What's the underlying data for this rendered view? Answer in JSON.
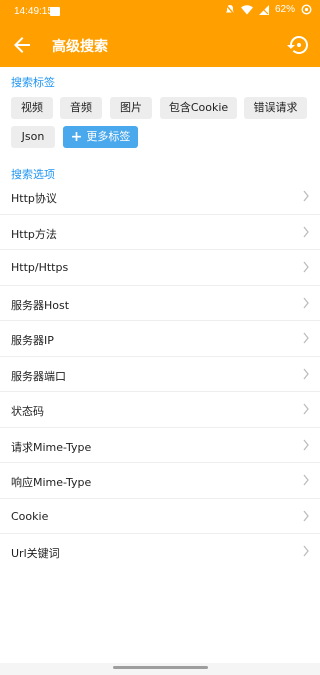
{
  "status": {
    "time": "14:49:15",
    "battery": "62%"
  },
  "toolbar": {
    "title": "高级搜索"
  },
  "tags_section": {
    "title": "搜索标签",
    "tags": [
      "视频",
      "音频",
      "图片",
      "包含Cookie",
      "错误请求",
      "Json"
    ],
    "more_label": "更多标签"
  },
  "options_section": {
    "title": "搜索选项",
    "items": [
      "Http协议",
      "Http方法",
      "Http/Https",
      "服务器Host",
      "服务器IP",
      "服务器端口",
      "状态码",
      "请求Mime-Type",
      "响应Mime-Type",
      "Cookie",
      "Url关键词"
    ]
  },
  "colors": {
    "accent": "#ff9f00",
    "section_title": "#2196f3",
    "more_button": "#4aa8ec"
  }
}
